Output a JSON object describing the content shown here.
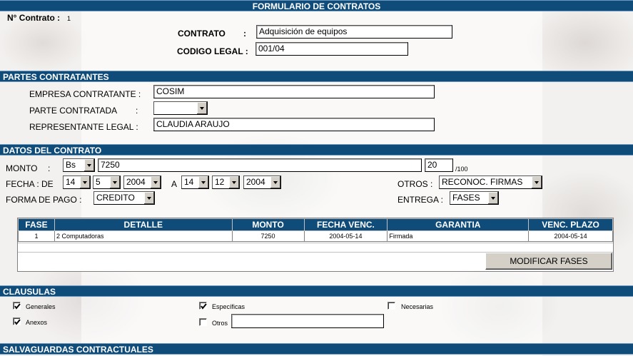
{
  "header": {
    "title": "FORMULARIO DE CONTRATOS"
  },
  "contrato": {
    "num_label": "N° Contrato :",
    "num_value": "1",
    "contrato_label": "CONTRATO",
    "colon": ":",
    "contrato_value": "Adquisición de equipos",
    "codigo_label": "CODIGO LEGAL :",
    "codigo_value": "001/04"
  },
  "partes": {
    "title": "PARTES CONTRATANTES",
    "empresa_label": "EMPRESA CONTRATANTE :",
    "empresa_value": "COSIM",
    "parte_label": "PARTE CONTRATADA",
    "parte_colon": ":",
    "parte_value": "",
    "representante_label": "REPRESENTANTE LEGAL :",
    "representante_value": "CLAUDIA ARAUJO"
  },
  "datos": {
    "title": "DATOS DEL CONTRATO",
    "monto_label": "MONTO",
    "monto_colon": ":",
    "moneda": "Bs",
    "monto_value": "7250",
    "centavos": "20",
    "centavos_suffix": "/100",
    "fecha_label": "FECHA : DE",
    "fecha_de_dia": "14",
    "fecha_de_mes": "5",
    "fecha_de_anio": "2004",
    "a_label": "A",
    "fecha_a_dia": "14",
    "fecha_a_mes": "12",
    "fecha_a_anio": "2004",
    "forma_pago_label": "FORMA DE PAGO :",
    "forma_pago_value": "CREDITO",
    "otros_label": "OTROS :",
    "otros_value": "RECONOC. FIRMAS",
    "entrega_label": "ENTREGA :",
    "entrega_value": "FASES"
  },
  "fases_table": {
    "headers": [
      "FASE",
      "DETALLE",
      "MONTO",
      "FECHA VENC.",
      "GARANTIA",
      "VENC. PLAZO"
    ],
    "rows": [
      [
        "1",
        "2 Computadoras",
        "7250",
        "2004-05-14",
        "Firmada",
        "2004-05-14"
      ]
    ],
    "modify_button": "MODIFICAR FASES"
  },
  "clausulas": {
    "title": "CLAUSULAS",
    "generales": "Generales",
    "especificas": "Específicas",
    "necesarias": "Necesarias",
    "anexos": "Anexos",
    "otros": "Otros",
    "otros_value": ""
  },
  "salvaguardas": {
    "title": "SALVAGUARDAS CONTRACTUALES"
  }
}
